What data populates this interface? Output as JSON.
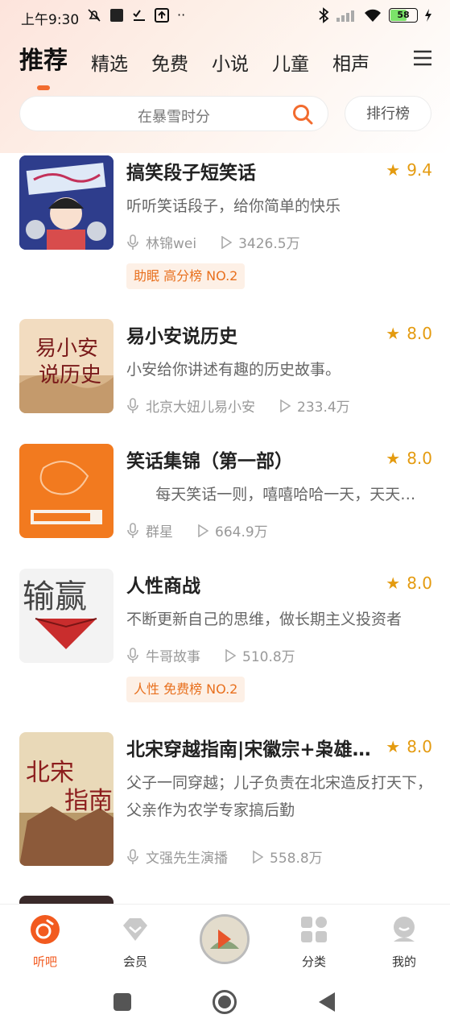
{
  "status": {
    "time": "上午9:30",
    "battery": "58"
  },
  "tabs": [
    "推荐",
    "精选",
    "免费",
    "小说",
    "儿童",
    "相声"
  ],
  "search": {
    "placeholder": "在暴雪时分",
    "rank_label": "排行榜"
  },
  "items": [
    {
      "title": "搞笑段子短笑话",
      "rating": "9.4",
      "desc": "听听笑话段子，给你简单的快乐",
      "author": "林锦wei",
      "plays": "3426.5万",
      "tag": "助眠 高分榜 NO.2"
    },
    {
      "title": "易小安说历史",
      "rating": "8.0",
      "desc": "小安给你讲述有趣的历史故事。",
      "author": "北京大妞儿易小安",
      "plays": "233.4万"
    },
    {
      "title": "笑话集锦（第一部）",
      "rating": "8.0",
      "desc": "      每天笑话一则，嘻嘻哈哈一天，天天…",
      "author": "群星",
      "plays": "664.9万"
    },
    {
      "title": "人性商战",
      "rating": "8.0",
      "desc": "不断更新自己的思维，做长期主义投资者",
      "author": "牛哥故事",
      "plays": "510.8万",
      "tag": "人性 免费榜 NO.2"
    },
    {
      "title": "北宋穿越指南|宋徽宗+枭雄…",
      "rating": "8.0",
      "desc": "父子一同穿越；儿子负责在北宋造反打天下，父亲作为农学专家搞后勤",
      "author": "文强先生演播",
      "plays": "558.8万"
    }
  ],
  "nav": {
    "listen": "听吧",
    "vip": "会员",
    "category": "分类",
    "mine": "我的"
  },
  "colors": {
    "accent": "#f26b2e",
    "star": "#e49b10",
    "tag_bg": "#fdf0e6"
  }
}
